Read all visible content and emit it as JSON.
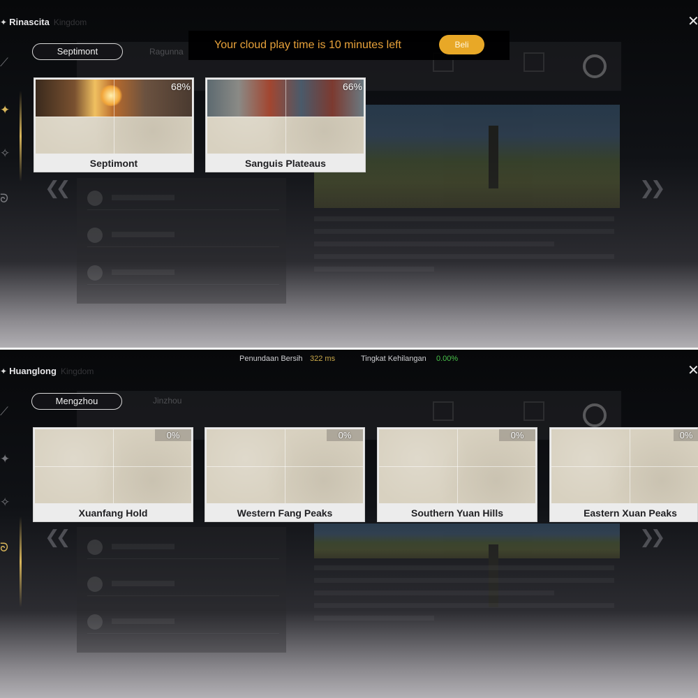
{
  "top": {
    "region_name": "Rinascita",
    "region_sub": "Kingdom",
    "tab_active": "Septimont",
    "tab_other": "Ragunna",
    "banner": {
      "message": "Your cloud play time is 10 minutes left",
      "button_label": "Beli"
    },
    "cards": [
      {
        "name": "Septimont",
        "percent": "68%"
      },
      {
        "name": "Sanguis Plateaus",
        "percent": "66%"
      }
    ]
  },
  "bottom": {
    "region_name": "Huanglong",
    "region_sub": "Kingdom",
    "tab_active": "Mengzhou",
    "tab_other": "Jinzhou",
    "stats": {
      "delay_label": "Penundaan Bersih",
      "delay_value": "322 ms",
      "loss_label": "Tingkat Kehilangan",
      "loss_value": "0.00%"
    },
    "cards": [
      {
        "name": "Xuanfang Hold",
        "percent": "0%"
      },
      {
        "name": "Western Fang Peaks",
        "percent": "0%"
      },
      {
        "name": "Southern Yuan Hills",
        "percent": "0%"
      },
      {
        "name": "Eastern Xuan Peaks",
        "percent": "0%"
      }
    ]
  },
  "colors": {
    "banner_text": "#e8a23a",
    "buy_button": "#e8a827",
    "delay_value": "#c9a84a",
    "loss_value": "#49c24a",
    "rail_active": "#d8b55a"
  },
  "icons": {
    "close": "close-x-icon",
    "prev": "double-chevron-left-icon",
    "next": "double-chevron-right-icon"
  }
}
